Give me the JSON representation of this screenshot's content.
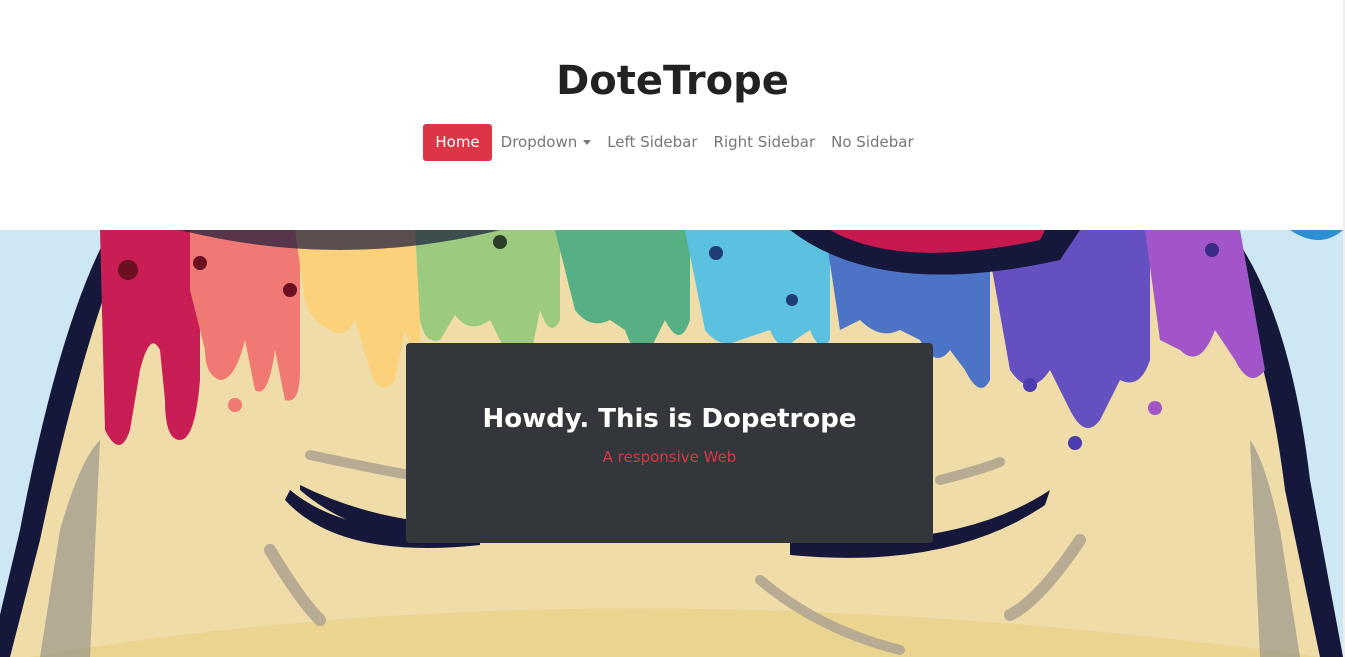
{
  "brand": {
    "title": "DoteTrope"
  },
  "nav": {
    "items": [
      {
        "label": "Home",
        "active": true
      },
      {
        "label": "Dropdown",
        "has_caret": true
      },
      {
        "label": "Left Sidebar"
      },
      {
        "label": "Right Sidebar"
      },
      {
        "label": "No Sidebar"
      }
    ]
  },
  "hero": {
    "title": "Howdy. This is Dopetrope",
    "subtitle": "A responsive Web"
  },
  "colors": {
    "accent": "#dc3545",
    "card_bg": "#33363b",
    "hero_sky": "#cde7f4",
    "face": "#efdca8"
  }
}
